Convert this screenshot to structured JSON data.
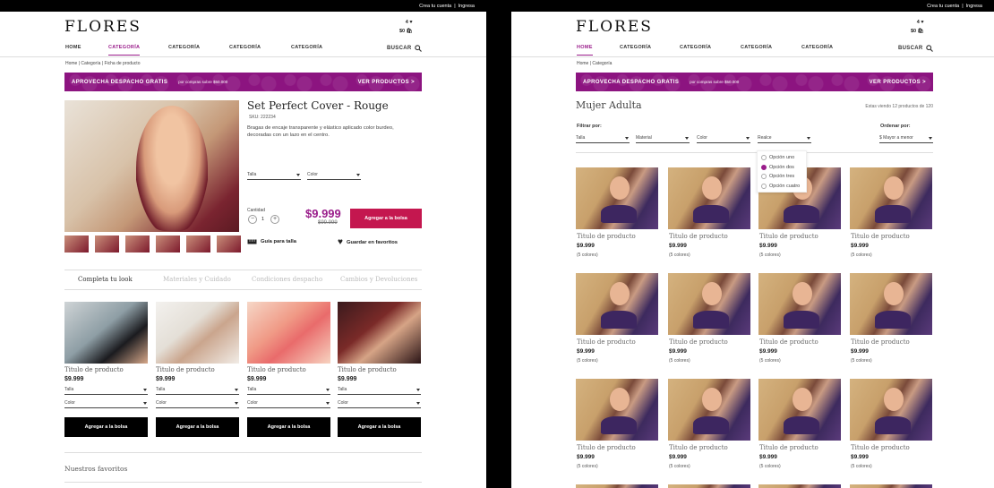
{
  "common": {
    "top_links": [
      "Crea tu cuenta",
      "|",
      "Ingresa"
    ],
    "logo": "FLORES",
    "cart_count": "4",
    "cart_total": "$0",
    "search_label": "BUSCAR",
    "promo_bold": "APROVECHA DESPACHO GRATIS",
    "promo_small": "por compras sobre $50.000",
    "promo_cta": "VER PRODUCTOS >",
    "accent": "#9a1d8b"
  },
  "left": {
    "nav": [
      "HOME",
      "CATEGORÍA",
      "CATEGORÍA",
      "CATEGORÍA",
      "CATEGORÍA"
    ],
    "breadcrumb": "Home | Categoría | Ficha de producto",
    "product": {
      "title": "Set Perfect Cover - Rouge",
      "sku": "SKU: 222234",
      "description": "Bragas de encaje transparente y elástico aplicado color burdeo, decoradas con un lazo en el centro.",
      "size_label": "Talla",
      "color_label": "Color",
      "quantity_label": "Cantidad",
      "quantity": "1",
      "minus": "−",
      "plus": "+",
      "price": "$9.999",
      "old_price": "$99.999",
      "add_label": "Agregar a la bolsa",
      "size_guide": "Guía para talla",
      "save_fav": "Guardar en favoritos"
    },
    "tabs": [
      "Completa tu look",
      "Materiales y Cuidado",
      "Condiciones despacho",
      "Cambios y Devoluciones"
    ],
    "cards": [
      {
        "title": "Titulo de producto",
        "price": "$9.999",
        "size": "Talla",
        "color": "Color",
        "btn": "Agregar a la bolsa"
      },
      {
        "title": "Titulo de producto",
        "price": "$9.999",
        "size": "Talla",
        "color": "Color",
        "btn": "Agregar a la bolsa"
      },
      {
        "title": "Titulo de producto",
        "price": "$9.999",
        "size": "Talla",
        "color": "Color",
        "btn": "Agregar a la bolsa"
      },
      {
        "title": "Titulo de producto",
        "price": "$9.999",
        "size": "Talla",
        "color": "Color",
        "btn": "Agregar a la bolsa"
      }
    ],
    "favorites_title": "Nuestros favoritos"
  },
  "right": {
    "nav": [
      "HOME",
      "CATEGORÍA",
      "CATEGORÍA",
      "CATEGORÍA",
      "CATEGORÍA"
    ],
    "breadcrumb": "Home | Categoría",
    "page_title": "Mujer Adulta",
    "viewing": "Estas viendo 12 productos de 120",
    "filter_label": "Filtrar por:",
    "sort_label": "Ordenar por:",
    "filters": [
      "Talla",
      "Material",
      "Color",
      "Realce"
    ],
    "sort_value": "$ Mayor a menor",
    "options": [
      "Opción uno",
      "Opción dos",
      "Opción tres",
      "Opción cuatro"
    ],
    "selected_option": 1,
    "product": {
      "title": "Titulo de producto",
      "price": "$9.999",
      "colors": "(5 colores)"
    }
  }
}
